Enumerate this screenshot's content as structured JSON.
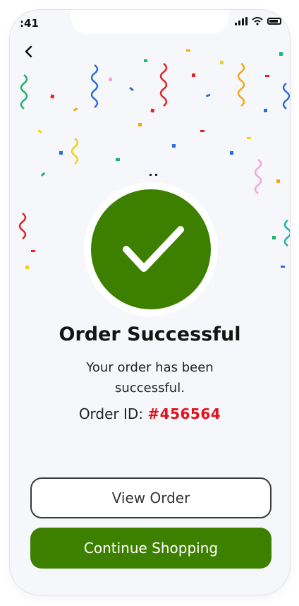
{
  "status_bar": {
    "time": ":41"
  },
  "header": {
    "back_label": ""
  },
  "success": {
    "title": "Order Successful",
    "message": "Your order has been successful.",
    "order_id_label": "Order ID:",
    "order_id_value": "#456564"
  },
  "actions": {
    "view_order_label": "View Order",
    "continue_label": "Continue Shopping"
  },
  "colors": {
    "brand_green": "#3d8000",
    "order_id_red": "#e0111b",
    "background": "#f6f7fb"
  },
  "icons": [
    "back-arrow-icon",
    "signal-icon",
    "wifi-icon",
    "battery-icon",
    "checkmark-icon",
    "confetti"
  ]
}
